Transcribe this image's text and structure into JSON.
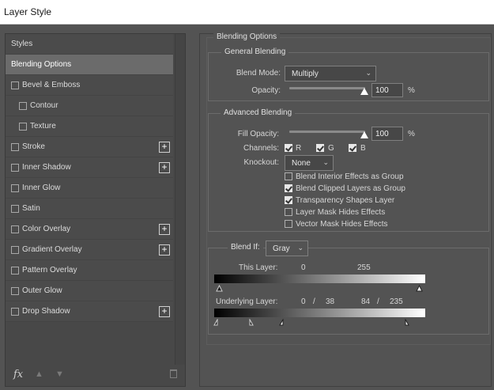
{
  "window": {
    "title": "Layer Style"
  },
  "styles_list": {
    "items": [
      {
        "label": "Styles",
        "checkbox": false,
        "indent": false,
        "plus": false,
        "selected": false
      },
      {
        "label": "Blending Options",
        "checkbox": false,
        "indent": false,
        "plus": false,
        "selected": true
      },
      {
        "label": "Bevel & Emboss",
        "checkbox": true,
        "indent": false,
        "plus": false,
        "selected": false
      },
      {
        "label": "Contour",
        "checkbox": true,
        "indent": true,
        "plus": false,
        "selected": false
      },
      {
        "label": "Texture",
        "checkbox": true,
        "indent": true,
        "plus": false,
        "selected": false
      },
      {
        "label": "Stroke",
        "checkbox": true,
        "indent": false,
        "plus": true,
        "selected": false
      },
      {
        "label": "Inner Shadow",
        "checkbox": true,
        "indent": false,
        "plus": true,
        "selected": false
      },
      {
        "label": "Inner Glow",
        "checkbox": true,
        "indent": false,
        "plus": false,
        "selected": false
      },
      {
        "label": "Satin",
        "checkbox": true,
        "indent": false,
        "plus": false,
        "selected": false
      },
      {
        "label": "Color Overlay",
        "checkbox": true,
        "indent": false,
        "plus": true,
        "selected": false
      },
      {
        "label": "Gradient Overlay",
        "checkbox": true,
        "indent": false,
        "plus": true,
        "selected": false
      },
      {
        "label": "Pattern Overlay",
        "checkbox": true,
        "indent": false,
        "plus": false,
        "selected": false
      },
      {
        "label": "Outer Glow",
        "checkbox": true,
        "indent": false,
        "plus": false,
        "selected": false
      },
      {
        "label": "Drop Shadow",
        "checkbox": true,
        "indent": false,
        "plus": true,
        "selected": false
      }
    ],
    "plus_symbol": "+",
    "footer": {
      "fx_label": "fx",
      "up_arrow": "▲",
      "down_arrow": "▼"
    }
  },
  "blending_options": {
    "title": "Blending Options",
    "general": {
      "title": "General Blending",
      "blend_mode_label": "Blend Mode:",
      "blend_mode_value": "Multiply",
      "opacity_label": "Opacity:",
      "opacity_value": "100",
      "opacity_level": 1.0,
      "unit": "%"
    },
    "advanced": {
      "title": "Advanced Blending",
      "fill_opacity_label": "Fill Opacity:",
      "fill_opacity_value": "100",
      "fill_opacity_level": 1.0,
      "unit": "%",
      "channels_label": "Channels:",
      "channels": [
        {
          "label": "R",
          "checked": true
        },
        {
          "label": "G",
          "checked": true
        },
        {
          "label": "B",
          "checked": true
        }
      ],
      "knockout_label": "Knockout:",
      "knockout_value": "None",
      "options": [
        {
          "label": "Blend Interior Effects as Group",
          "checked": false
        },
        {
          "label": "Blend Clipped Layers as Group",
          "checked": true
        },
        {
          "label": "Transparency Shapes Layer",
          "checked": true
        },
        {
          "label": "Layer Mask Hides Effects",
          "checked": false
        },
        {
          "label": "Vector Mask Hides Effects",
          "checked": false
        }
      ]
    },
    "blend_if": {
      "label": "Blend If:",
      "value": "Gray",
      "this_layer_label": "This Layer:",
      "this_layer_low": "0",
      "this_layer_high": "255",
      "underlying_label": "Underlying Layer:",
      "underlying_low_a": "0",
      "underlying_sep1": "/",
      "underlying_low_b": "38",
      "underlying_high_a": "84",
      "underlying_sep2": "/",
      "underlying_high_b": "235"
    }
  }
}
